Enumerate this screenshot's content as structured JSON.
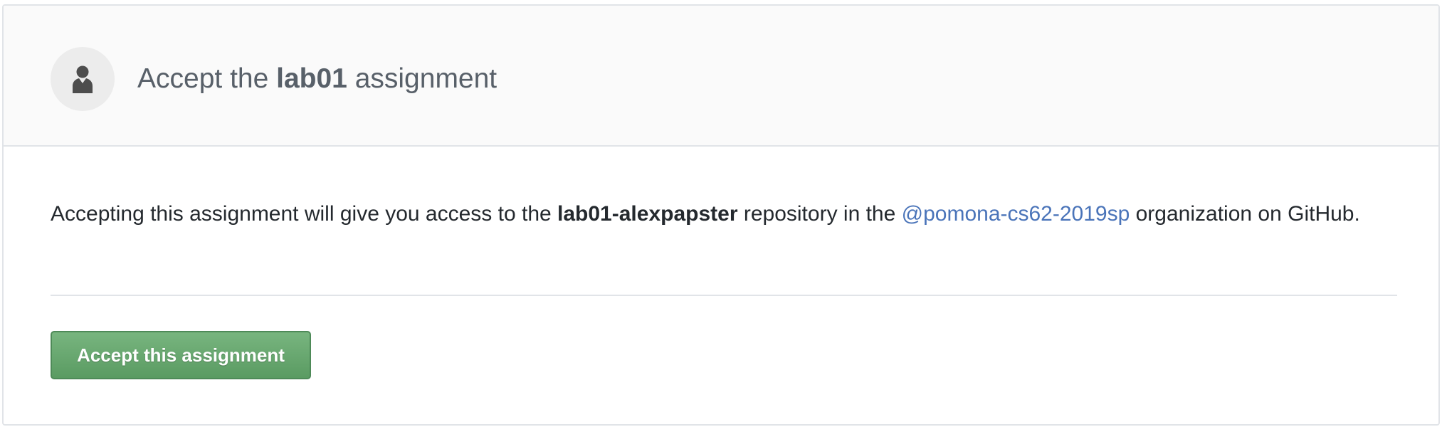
{
  "header": {
    "avatar_icon": "user-silhouette-icon",
    "title_prefix": "Accept the",
    "assignment_name": "lab01",
    "title_suffix": "assignment"
  },
  "body": {
    "text_part1": "Accepting this assignment will give you access to the",
    "repository_name": "lab01-alexpapster",
    "text_part2": "repository in the",
    "organization_link": "@pomona-cs62-2019sp",
    "text_part3": "organization on GitHub."
  },
  "actions": {
    "accept_button_label": "Accept this assignment"
  },
  "colors": {
    "header_background": "#fafafa",
    "title_text": "#586069",
    "body_text": "#24292e",
    "link": "#4a74b9",
    "button_green": "#5a9b62",
    "border": "#e1e4e8"
  }
}
